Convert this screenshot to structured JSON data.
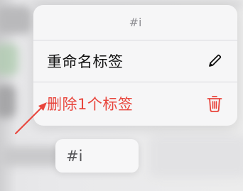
{
  "menu": {
    "header": "#i",
    "items": [
      {
        "label": "重命名标签",
        "icon": "pencil-icon"
      },
      {
        "label": "删除1个标签",
        "icon": "trash-icon"
      }
    ]
  },
  "preview": {
    "text": "#i"
  },
  "colors": {
    "destructive": "#e8453c",
    "annotation_arrow": "#e8453c",
    "menu_background": "#f6f6f7"
  }
}
